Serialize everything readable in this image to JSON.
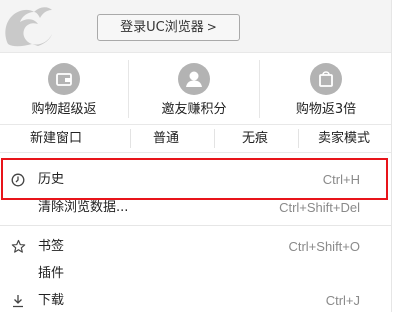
{
  "header": {
    "login_label": "登录UC浏览器",
    "login_arrow": ">"
  },
  "shortcuts": [
    {
      "label": "购物超级返",
      "icon": "wallet-icon"
    },
    {
      "label": "邀友赚积分",
      "icon": "user-icon"
    },
    {
      "label": "购物返3倍",
      "icon": "shopping-bag-icon"
    }
  ],
  "window_row": {
    "new_window": "新建窗口",
    "normal": "普通",
    "incognito": "无痕",
    "seller_mode": "卖家模式"
  },
  "menu_items": {
    "history": {
      "label": "历史",
      "shortcut": "Ctrl+H",
      "icon": "clock-icon"
    },
    "clear_data": {
      "label": "清除浏览数据...",
      "shortcut": "Ctrl+Shift+Del"
    },
    "bookmarks": {
      "label": "书签",
      "shortcut": "Ctrl+Shift+O",
      "icon": "star-icon"
    },
    "plugins": {
      "label": "插件"
    },
    "downloads": {
      "label": "下载",
      "shortcut": "Ctrl+J",
      "icon": "download-icon"
    }
  },
  "colors": {
    "highlight_border": "#e8141a",
    "icon_gray": "#b3b3b3"
  }
}
